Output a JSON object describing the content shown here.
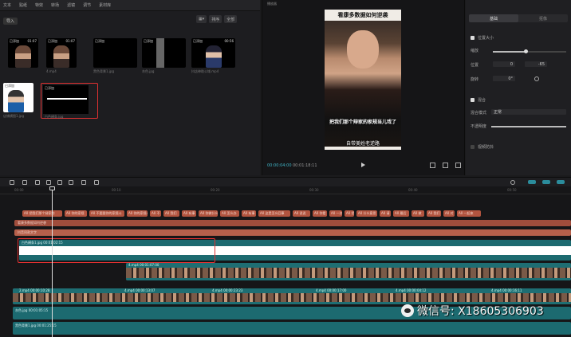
{
  "menu": [
    "文本",
    "贴纸",
    "特效",
    "转场",
    "滤镜",
    "调节",
    "素材库"
  ],
  "media": {
    "import_label": "导入",
    "sort_label": "排序",
    "all_label": "全部",
    "items": [
      {
        "tag": "已添加",
        "duration": "01:07",
        "caption": ""
      },
      {
        "tag": "已添加",
        "duration": "01:07",
        "caption": "4.mp4"
      },
      {
        "tag": "已添加",
        "duration": "",
        "caption": "黑色背景1.jpg"
      },
      {
        "tag": "已添加",
        "duration": "",
        "caption": "灰色.jpg"
      },
      {
        "tag": "已添加",
        "duration": "00:56",
        "caption": "抖店神助公域.mp4"
      },
      {
        "tag": "已添加",
        "duration": "",
        "caption": "店铺横图1.jpg"
      },
      {
        "tag": "已添加",
        "duration": "",
        "caption": "白色横条.jpg"
      }
    ]
  },
  "preview": {
    "title": "播放器",
    "caption_top": "看康多数据如何逆袭",
    "subtitle_1": "把我们那个辩家的家规当儿戏了",
    "subtitle_2": "自带美姓老逆路",
    "time_current": "00:00:04:00",
    "time_total": "00:01:18:11"
  },
  "inspector": {
    "tabs": [
      "基础",
      "抠像"
    ],
    "position_size": "位置大小",
    "scale_label": "缩放",
    "position_label": "位置",
    "x_value": "0",
    "y_value": "-65",
    "rotate_label": "旋转",
    "rotate_value": "0°",
    "blend_label": "混合",
    "blend_mode_label": "混合模式",
    "blend_mode_value": "正常",
    "opacity_label": "不透明度",
    "stabilize_label": "视频防抖",
    "scale_fraction": 0.45
  },
  "ruler": [
    "00:00",
    "00:10",
    "00:20",
    "00:30",
    "00:40",
    "00:50"
  ],
  "timeline": {
    "text_chips": [
      "A0 把我们那个辩家的",
      "A0 你的家规",
      "A0 不要跟你的家规斗",
      "A0 你的家规斗了",
      "A0 不",
      "A0 我们",
      "A0 有事",
      "A0 你做什么",
      "A0 怎么办",
      "A0 有事",
      "A0 这是怎么回事",
      "A0 说说",
      "A0 你看",
      "A0 一次",
      "A0 把",
      "A0 什么意思",
      "A0 请",
      "A0 最后",
      "A0 做",
      "A0 我们",
      "A0 对",
      "A0 一起来"
    ],
    "bar_1": "看康多数据如何逆袭",
    "bar_2": "抖音同款文字",
    "bar_3": "",
    "clip_selected": "白色横条1.jpg  00:01:02:15",
    "clip_4mp4": "4.mp4  00:01:07:00",
    "main_track_labels": [
      "2.mp4  00:00:10:28",
      "4.mp4  00:00:13:07",
      "4.mp4  00:00:23:23",
      "4.mp4  00:00:17:00",
      "4.mp4  00:00:04:12",
      "4.mp4  00:00:16:11"
    ],
    "clip_gray": "灰色.jpg  00:01:05:15",
    "clip_black": "黑色背景1.jpg  00:01:25:15"
  },
  "watermark": "微信号: X18605306903"
}
